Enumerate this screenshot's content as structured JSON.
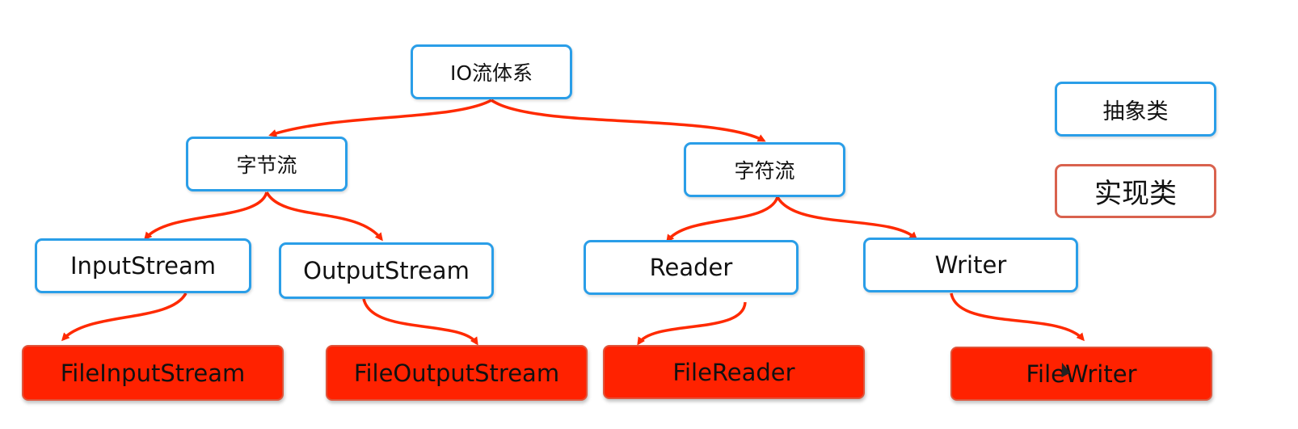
{
  "diagram": {
    "root": "IO流体系",
    "byte_stream": "字节流",
    "char_stream": "字符流",
    "input_stream": "InputStream",
    "output_stream": "OutputStream",
    "reader": "Reader",
    "writer": "Writer",
    "file_input_stream": "FileInputStream",
    "file_output_stream": "FileOutputStream",
    "file_reader": "FileReader",
    "file_writer": "FileWriter"
  },
  "legend": {
    "abstract_label": "抽象类",
    "impl_label": "实现类"
  },
  "colors": {
    "abstract_border": "#2a9ee8",
    "impl_fill": "#ff2200",
    "arrow": "#ff2a00",
    "legend_impl_border": "#d9624e"
  }
}
